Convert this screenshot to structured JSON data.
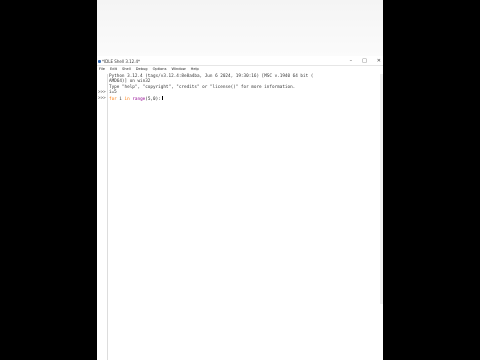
{
  "window": {
    "title": "*IDLE Shell 3.12.4*",
    "controls": [
      "–",
      "□",
      "✕"
    ]
  },
  "menubar": [
    "File",
    "Edit",
    "Shell",
    "Debug",
    "Options",
    "Window",
    "Help"
  ],
  "gutter": [
    "",
    "",
    "",
    ">>>",
    ">>>"
  ],
  "shell": {
    "banner_line1": "Python 3.12.4 (tags/v3.12.4:8e8a4ba, Jun  6 2024, 19:30:16) [MSC v.1940 64 bit (",
    "banner_line2": "AMD64)] on win32",
    "banner_line3": "Type \"help\", \"copyright\", \"credits\" or \"license()\" for more information.",
    "input1": "i=5",
    "input2_kw": "for",
    "input2_var": " i ",
    "input2_in": "in",
    "input2_fn": " range",
    "input2_args": "(5,0):"
  },
  "colors": {
    "keyword": "#ff7700",
    "builtin": "#900090",
    "background": "#ffffff",
    "letterbox": "#000000"
  }
}
